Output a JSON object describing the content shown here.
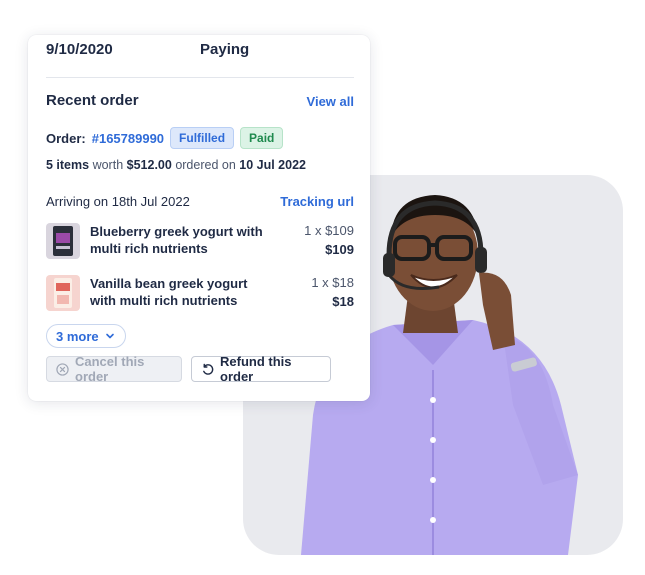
{
  "header": {
    "date": "9/10/2020",
    "status": "Paying"
  },
  "recent_order": {
    "title": "Recent order",
    "view_all": "View all",
    "order_label": "Order:",
    "order_id": "#165789990",
    "badges": {
      "fulfilled": "Fulfilled",
      "paid": "Paid"
    },
    "summary": {
      "items": "5 items",
      "worth": "worth",
      "amount": "$512.00",
      "ordered_on": "ordered on",
      "date": "10 Jul 2022"
    },
    "arriving": "Arriving on 18th Jul 2022",
    "tracking": "Tracking url",
    "items": [
      {
        "name": "Blueberry greek yogurt with multi rich nutrients",
        "qty": "1 x $109",
        "price": "$109",
        "thumb_color": "#2b2f3a"
      },
      {
        "name": "Vanilla bean greek yogurt with multi rich nutrients",
        "qty": "1 x $18",
        "price": "$18",
        "thumb_color": "#f6d4cf"
      }
    ],
    "more": "3 more",
    "cancel_label": "Cancel this order",
    "refund_label": "Refund this order"
  },
  "colors": {
    "accent": "#2f6bd8",
    "paid_green": "#1f8a4e",
    "shirt": "#b6a9ef",
    "photo_bg": "#e9eaee"
  }
}
